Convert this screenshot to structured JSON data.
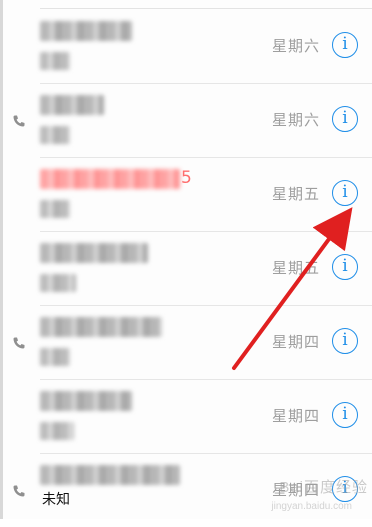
{
  "calls": [
    {
      "day": "星期六",
      "name_style": "gray",
      "name_width": 92,
      "sub_width": 30,
      "has_phone_icon": false
    },
    {
      "day": "星期六",
      "name_style": "gray",
      "name_width": 64,
      "sub_width": 30,
      "has_phone_icon": true
    },
    {
      "day": "星期五",
      "name_style": "red",
      "name_width": 140,
      "sub_width": 30,
      "has_phone_icon": false,
      "name_tail": "5"
    },
    {
      "day": "星期五",
      "name_style": "gray",
      "name_width": 108,
      "sub_width": 36,
      "has_phone_icon": false
    },
    {
      "day": "星期四",
      "name_style": "gray",
      "name_width": 122,
      "sub_width": 30,
      "has_phone_icon": true
    },
    {
      "day": "星期四",
      "name_style": "gray",
      "name_width": 92,
      "sub_width": 34,
      "has_phone_icon": false
    },
    {
      "day": "星期四",
      "name_style": "gray",
      "name_width": 140,
      "sub_width": 0,
      "has_phone_icon": true,
      "sub_label": "未知"
    }
  ],
  "info_icon_glyph": "i",
  "annotation": {
    "color": "#e02020"
  },
  "watermark": {
    "brand": "Bai百度经验",
    "url": "jingyan.baidu.com"
  }
}
